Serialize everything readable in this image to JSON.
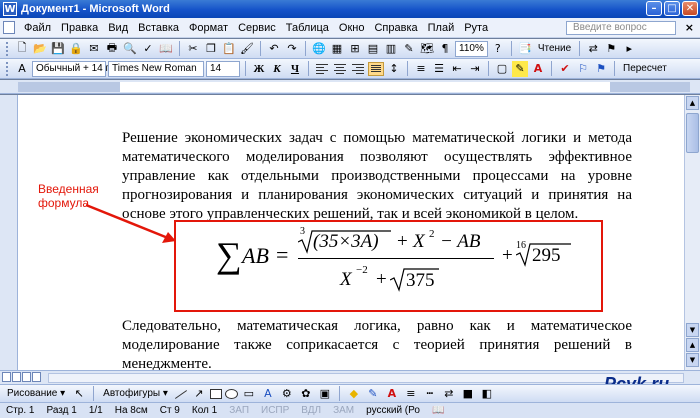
{
  "window": {
    "title": "Документ1 - Microsoft Word",
    "app_icon": "W"
  },
  "menu": {
    "items": [
      "Файл",
      "Правка",
      "Вид",
      "Вставка",
      "Формат",
      "Сервис",
      "Таблица",
      "Окно",
      "Справка",
      "Плай",
      "Рута"
    ],
    "ask_placeholder": "Введите вопрос"
  },
  "toolbar_standard": {
    "zoom": "110%",
    "reading_label": "Чтение"
  },
  "toolbar_format": {
    "style": "Обычный + 14 г",
    "font": "Times New Roman",
    "size": "14",
    "bold": "Ж",
    "italic": "К",
    "underline": "Ч",
    "translate_label": "Пересчет"
  },
  "document": {
    "paragraph1": "Решение экономических задач с помощью математической логики и метода математического моделирования позволяют осуществлять эффективное управление как отдельными производственными процессами на уровне прогнозирования и планирования экономических ситуаций и принятия на основе этого управленческих решений, так и всей экономикой в целом.",
    "paragraph2": "Следовательно, математическая логика, равно как и математическое моделирование также соприкасается с теорией принятия решений в менеджменте.",
    "annotation": "Введенная формула",
    "annotation_color": "#e3170a",
    "formula": {
      "sum": "∑",
      "lhs": "AB",
      "eq": "=",
      "root1_index": "3",
      "root1_radicand": "(35×3A)",
      "plus1": "+",
      "x": "X",
      "exp2": "2",
      "minus": "− AB",
      "denom_x": "X",
      "exp_neg2": "−2",
      "plus2": "+",
      "root2_radicand": "375",
      "plus3": "+",
      "root3_index": "16",
      "root3_radicand": "295"
    }
  },
  "drawing_toolbar": {
    "draw_label": "Рисование ▾",
    "autoshapes_label": "Автофигуры ▾"
  },
  "status": {
    "page": "Стр. 1",
    "section": "Разд 1",
    "pages": "1/1",
    "at": "На 8см",
    "line": "Ст 9",
    "col": "Кол 1",
    "rec": "ЗАП",
    "trk": "ИСПР",
    "ext": "ВДЛ",
    "ovr": "ЗАМ",
    "lang": "русский (Ро"
  },
  "watermark": {
    "text": "Pcyk",
    "dot": ".",
    "tld": "ru"
  }
}
